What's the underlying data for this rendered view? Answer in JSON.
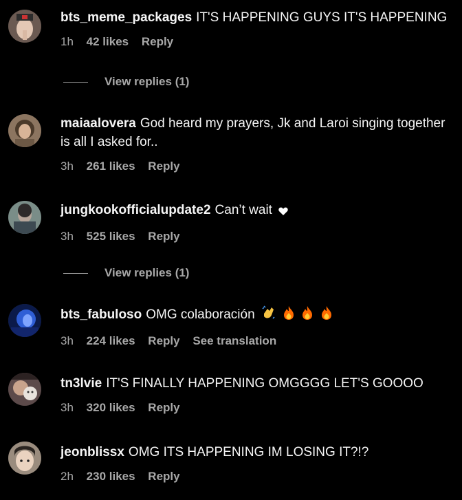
{
  "comments": [
    {
      "username": "bts_meme_packages",
      "text": "IT'S HAPPENING GUYS IT'S HAPPENING",
      "time": "1h",
      "likes": "42 likes",
      "reply": "Reply",
      "view_replies": "View replies (1)"
    },
    {
      "username": "maiaalovera",
      "text": "God heard my prayers, Jk and Laroi singing together is all I asked for..",
      "time": "3h",
      "likes": "261 likes",
      "reply": "Reply"
    },
    {
      "username": "jungkookofficialupdate2",
      "text": "Can’t wait",
      "time": "3h",
      "likes": "525 likes",
      "reply": "Reply",
      "view_replies": "View replies (1)"
    },
    {
      "username": "bts_fabuloso",
      "text": "OMG colaboración",
      "time": "3h",
      "likes": "224 likes",
      "reply": "Reply",
      "translate": "See translation"
    },
    {
      "username": "tn3lvie",
      "text": "IT'S FINALLY HAPPENING OMGGGG LET'S GOOOO",
      "time": "3h",
      "likes": "320 likes",
      "reply": "Reply"
    },
    {
      "username": "jeonblissx",
      "text": "OMG ITS HAPPENING IM LOSING IT?!?",
      "time": "2h",
      "likes": "230 likes",
      "reply": "Reply"
    }
  ],
  "colors": {
    "background": "#000000",
    "text": "#f5f5f5",
    "secondary": "#a8a8a8",
    "fire": "#ff6a00"
  }
}
